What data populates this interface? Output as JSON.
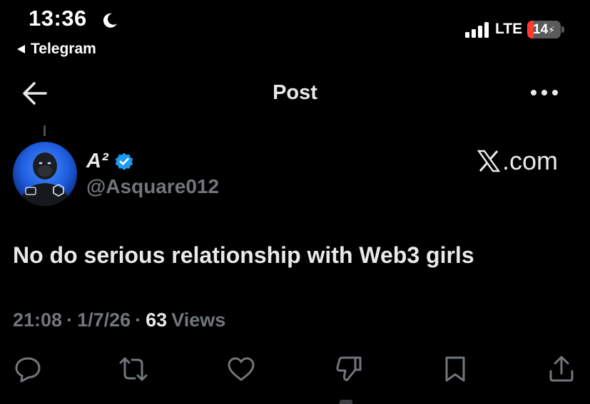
{
  "status_bar": {
    "time": "13:36",
    "back_app": "Telegram",
    "network": "LTE",
    "battery_level": "14",
    "battery_fraction": 0.14,
    "battery_color": "#ff3b30"
  },
  "header": {
    "title": "Post",
    "back_icon": "back-arrow-icon",
    "more_icon": "more-options-icon"
  },
  "post": {
    "author_name": "A²",
    "verified": true,
    "verified_color": "#1d9bf0",
    "handle": "@Asquare012",
    "watermark_text": ".com",
    "text": "No do serious relationship with Web3 girls",
    "time": "21:08",
    "date": "1/7/26",
    "separator": "·",
    "views_count": "63",
    "views_label": "Views"
  },
  "actions": [
    {
      "name": "reply",
      "icon": "comment-icon"
    },
    {
      "name": "repost",
      "icon": "repost-icon"
    },
    {
      "name": "like",
      "icon": "heart-icon"
    },
    {
      "name": "dislike",
      "icon": "thumbs-down-icon"
    },
    {
      "name": "bookmark",
      "icon": "bookmark-icon"
    },
    {
      "name": "share",
      "icon": "share-icon"
    }
  ],
  "colors": {
    "background": "#000000",
    "text_primary": "#e7e9ea",
    "text_secondary": "#71767b",
    "accent": "#1d9bf0"
  }
}
